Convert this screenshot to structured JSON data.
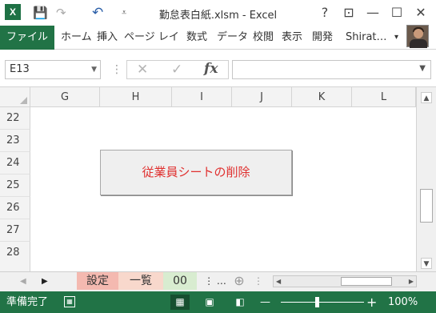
{
  "window": {
    "title": "勤怠表白紙.xlsm - Excel",
    "app_icon": "X",
    "quick_access": {
      "save_icon": "💾",
      "redo_icon": "↷",
      "undo_icon": "↶",
      "customize_icon": "⩡"
    },
    "controls": {
      "help": "?",
      "restore_ribbon": "⊡",
      "minimize": "—",
      "maximize": "☐",
      "close": "✕"
    }
  },
  "ribbon": {
    "file_tab": "ファイル",
    "tabs": [
      "ホーム",
      "挿入",
      "ページ レイ",
      "数式",
      "データ",
      "校閲",
      "表示",
      "開発",
      "Shirat…"
    ],
    "user_menu_arrow": "▾"
  },
  "formula_bar": {
    "name_box": "E13",
    "separator": "⋮",
    "cancel_icon": "✕",
    "enter_icon": "✓",
    "fx_label": "fx",
    "formula_value": ""
  },
  "grid": {
    "columns": [
      "G",
      "H",
      "I",
      "J",
      "K",
      "L"
    ],
    "rows": [
      "22",
      "23",
      "24",
      "25",
      "26",
      "27",
      "28"
    ],
    "macro_button_label": "従業員シートの削除"
  },
  "sheet_tabs": {
    "tabs": [
      {
        "label": "設定",
        "color": "#f4b9b0"
      },
      {
        "label": "一覧",
        "color": "#f8d8cc"
      },
      {
        "label": "00",
        "color": "#d8ecd0"
      }
    ],
    "more": "⋮ …",
    "add_icon": "⊕"
  },
  "status_bar": {
    "ready_text": "準備完了",
    "zoom_minus": "—",
    "zoom_plus": "+",
    "zoom_level": "100%"
  },
  "colors": {
    "excel_green": "#217346",
    "macro_text": "#e0302f"
  }
}
